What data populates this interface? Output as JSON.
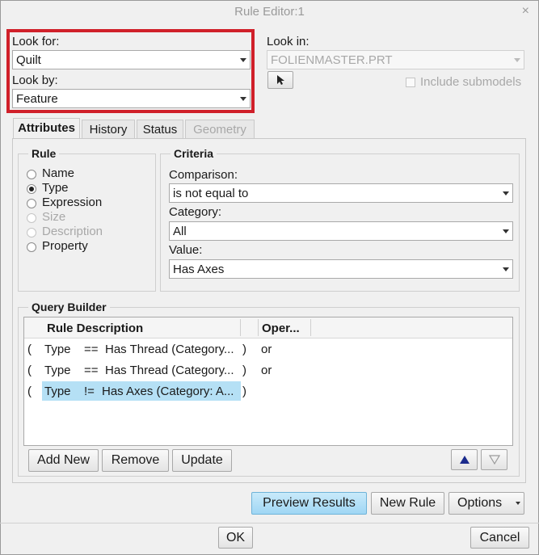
{
  "window": {
    "title": "Rule Editor:1",
    "close_glyph": "×"
  },
  "look_for": {
    "label": "Look for:",
    "value": "Quilt"
  },
  "look_by": {
    "label": "Look by:",
    "value": "Feature"
  },
  "look_in": {
    "label": "Look in:",
    "value": "FOLIENMASTER.PRT",
    "include_submodels": "Include submodels",
    "pick_icon": "cursor-arrow-icon"
  },
  "tabs": [
    {
      "label": "Attributes",
      "active": true
    },
    {
      "label": "History"
    },
    {
      "label": "Status"
    },
    {
      "label": "Geometry",
      "disabled": true
    }
  ],
  "rule": {
    "title": "Rule",
    "options": [
      {
        "label": "Name"
      },
      {
        "label": "Type",
        "selected": true
      },
      {
        "label": "Expression"
      },
      {
        "label": "Size",
        "disabled": true
      },
      {
        "label": "Description",
        "disabled": true
      },
      {
        "label": "Property"
      }
    ]
  },
  "criteria": {
    "title": "Criteria",
    "comparison_label": "Comparison:",
    "comparison_value": "is not equal to",
    "category_label": "Category:",
    "category_value": "All",
    "value_label": "Value:",
    "value_value": "Has Axes"
  },
  "query_builder": {
    "title": "Query Builder",
    "columns": [
      "Rule Description",
      "Oper..."
    ],
    "rows": [
      {
        "open": "(",
        "type": "Type",
        "op": "==",
        "desc": "Has Thread (Category...",
        "close": ")",
        "oper": "or"
      },
      {
        "open": "(",
        "type": "Type",
        "op": "==",
        "desc": "Has Thread (Category...",
        "close": ")",
        "oper": "or"
      },
      {
        "open": "(",
        "type": "Type",
        "op": "!=",
        "desc": "Has Axes (Category: A...",
        "close": ")",
        "oper": ""
      }
    ],
    "buttons": {
      "add_new": "Add New",
      "remove": "Remove",
      "update": "Update"
    }
  },
  "footer": {
    "preview_results": "Preview Results",
    "new_rule": "New Rule",
    "options": "Options",
    "ok": "OK",
    "cancel": "Cancel"
  }
}
